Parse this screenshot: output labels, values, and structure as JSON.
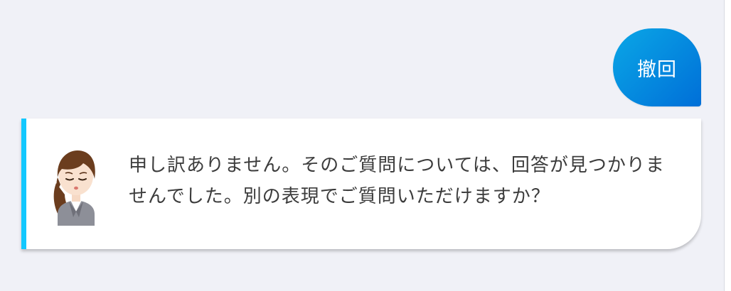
{
  "user_message": {
    "text": "撤回"
  },
  "bot_message": {
    "text": "申し訳ありません。そのご質問については、回答が見つかりませんでした。別の表現でご質問いただけますか？",
    "avatar_icon": "woman-operator-avatar-icon"
  },
  "colors": {
    "background": "#f0f1f7",
    "user_bubble_start": "#0aa7e6",
    "user_bubble_end": "#006fd8",
    "bot_accent": "#12c8ff",
    "bot_text": "#3c3c3c"
  }
}
